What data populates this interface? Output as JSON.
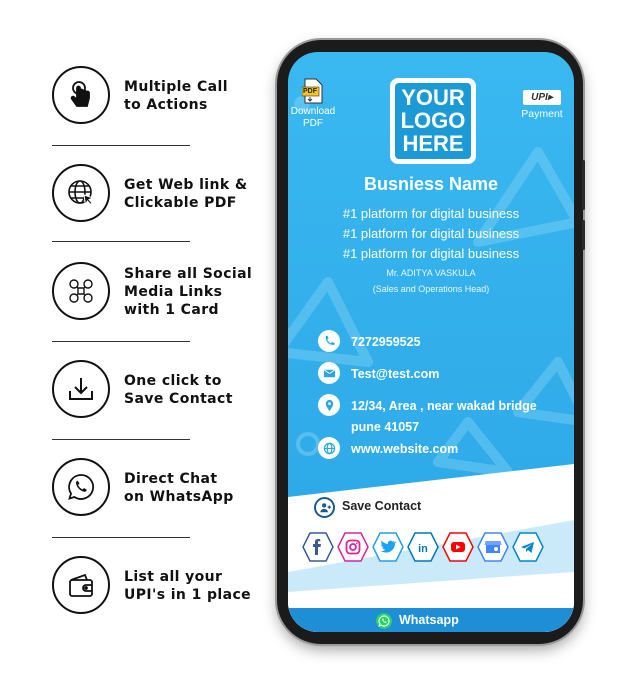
{
  "features": [
    {
      "label": "Multiple Call\nto Actions",
      "icon": "tap-hand-icon"
    },
    {
      "label": "Get Web link &\nClickable PDF",
      "icon": "globe-cursor-icon"
    },
    {
      "label": "Share all Social\nMedia Links\nwith 1 Card",
      "icon": "social-share-icon"
    },
    {
      "label": "One click to\nSave Contact",
      "icon": "download-icon"
    },
    {
      "label": "Direct Chat\non WhatsApp",
      "icon": "whatsapp-icon"
    },
    {
      "label": "List all your\nUPI's in 1 place",
      "icon": "wallet-icon"
    }
  ],
  "card": {
    "pdf_badge": "PDF",
    "pdf_label": "Download\nPDF",
    "upi_logo": "UPI▸",
    "upi_label": "Payment",
    "logo_text": "YOUR\nLOGO\nHERE",
    "business_name": "Busniess Name",
    "taglines": [
      "#1 platform for digital business",
      "#1 platform for digital business",
      "#1 platform for digital business"
    ],
    "person_name": "Mr. ADITYA VASKULA",
    "person_title": "(Sales and Operations Head)",
    "phone": "7272959525",
    "email": "Test@test.com",
    "address": "12/34, Area , near wakad bridge\npune 41057",
    "website": "www.website.com",
    "save_contact": "Save Contact",
    "whatsapp": "Whatsapp",
    "social_icons": [
      "facebook-icon",
      "instagram-icon",
      "twitter-icon",
      "linkedin-icon",
      "youtube-icon",
      "google-my-business-icon",
      "telegram-icon"
    ]
  },
  "colors": {
    "screen_blue": "#2aa6e6",
    "logo_blue": "#1b9ad6",
    "whatsapp_green": "#25d366",
    "text_dark": "#111111"
  }
}
